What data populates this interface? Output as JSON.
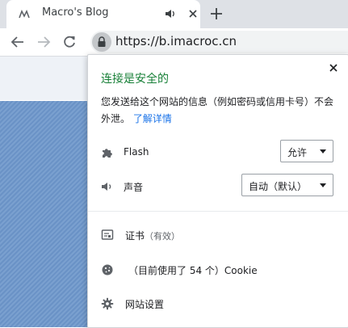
{
  "tab": {
    "title": "Macro's Blog"
  },
  "toolbar": {
    "url": "https://b.imacroc.cn"
  },
  "popup": {
    "secure_title": "连接是安全的",
    "description": "您发送给这个网站的信息（例如密码或信用卡号）不会外泄。",
    "learn_more": "了解详情",
    "permissions": [
      {
        "label": "Flash",
        "value": "允许",
        "icon": "puzzle-icon"
      },
      {
        "label": "声音",
        "value": "自动（默认）",
        "icon": "speaker-icon"
      }
    ],
    "certificate": {
      "label": "证书",
      "status": "（有效）",
      "icon": "certificate-icon"
    },
    "cookies": {
      "label": "（目前使用了 54 个）Cookie",
      "icon": "cookie-icon"
    },
    "site_settings": {
      "label": "网站设置",
      "icon": "gear-icon"
    }
  },
  "colors": {
    "secure_green": "#188038",
    "link_blue": "#1a73e8",
    "page_stripe": "#7aa0cf"
  }
}
